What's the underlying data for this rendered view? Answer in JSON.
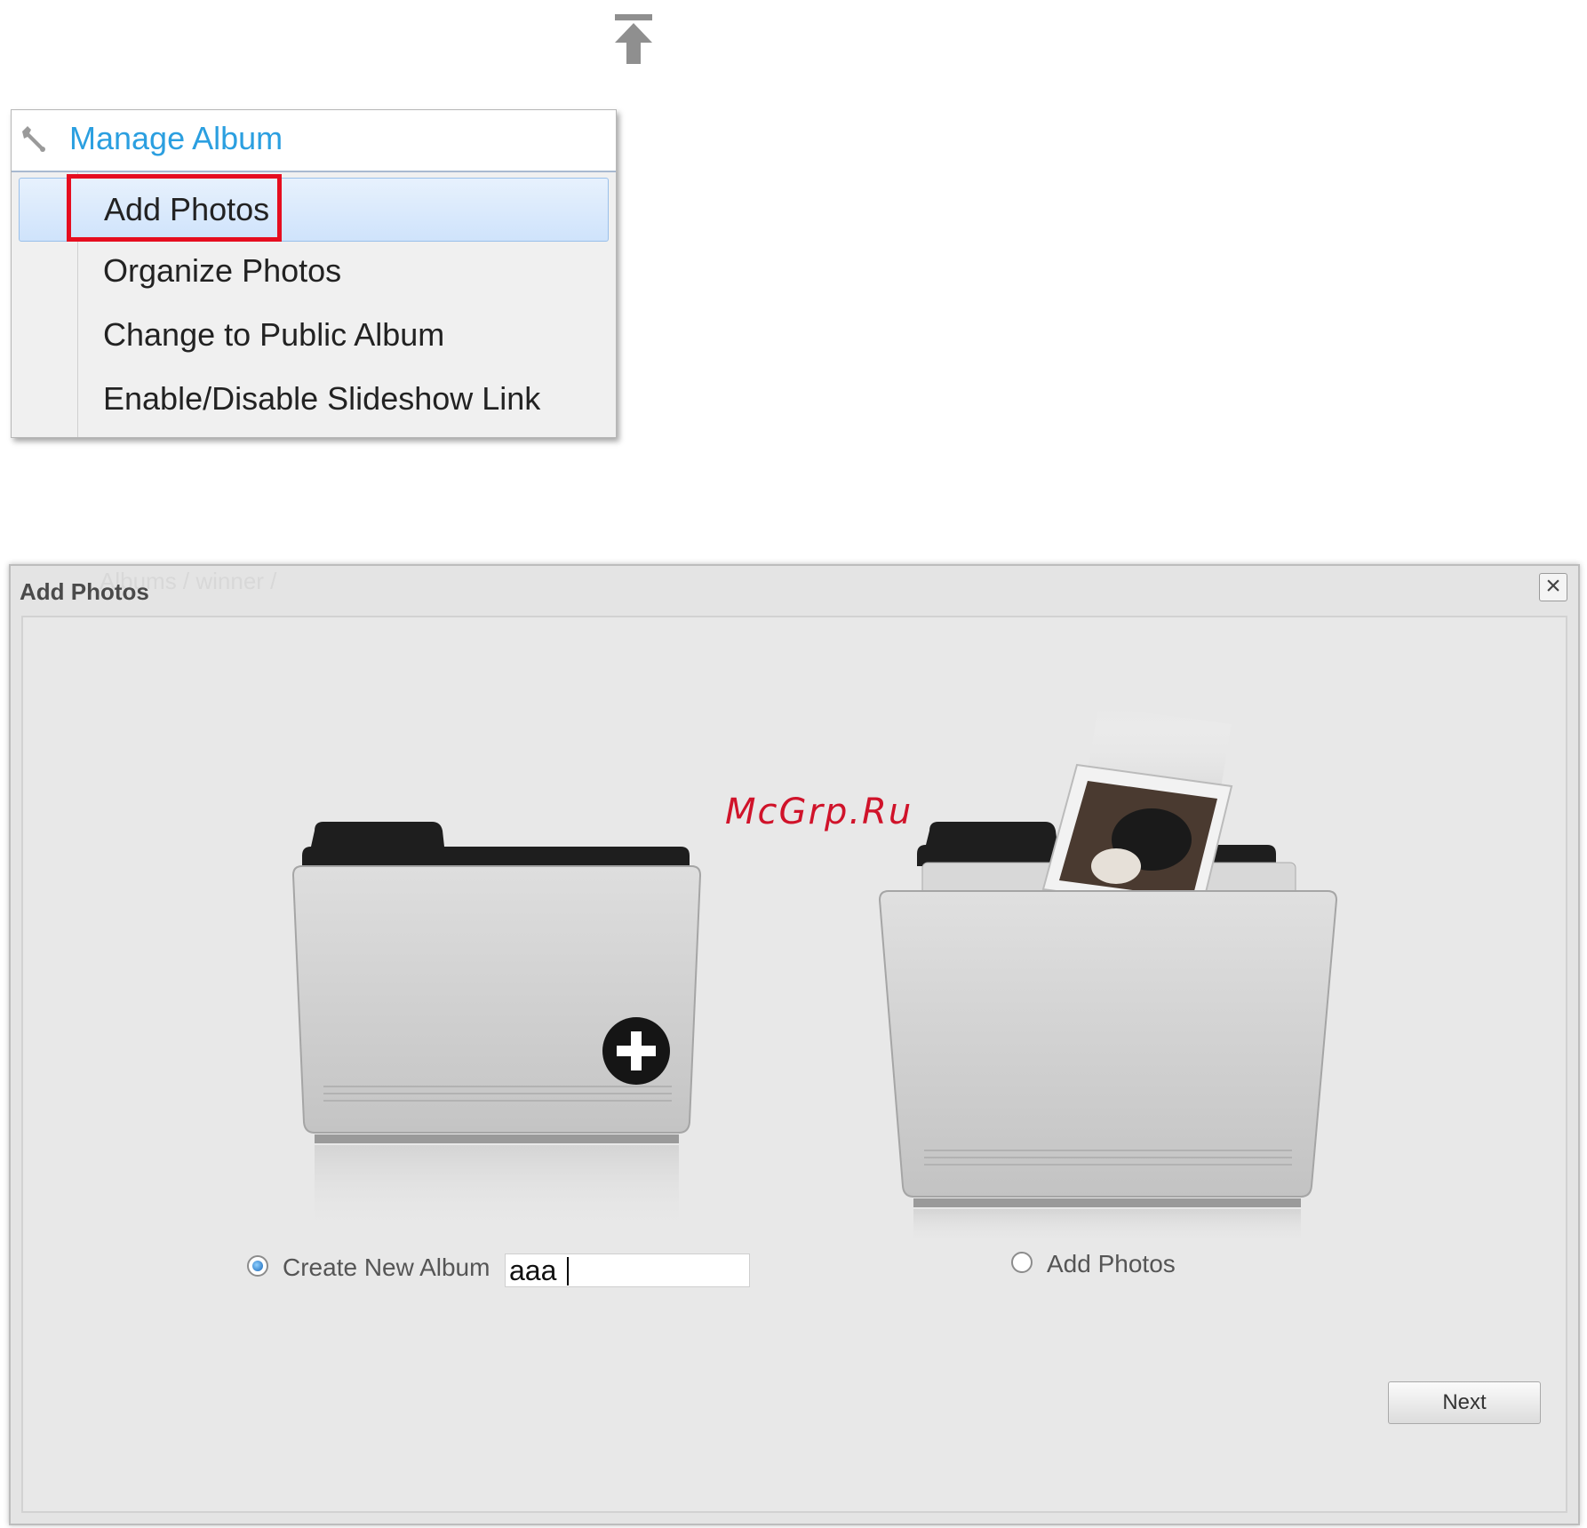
{
  "icons": {
    "upload": "upload-to-top-icon",
    "wrench": "wrench-icon",
    "close": "close-icon",
    "new_folder": "folder-plus-icon",
    "photo_folder": "folder-with-photo-icon"
  },
  "menu": {
    "title": "Manage Album",
    "items": [
      {
        "label": "Add Photos",
        "selected": true
      },
      {
        "label": "Organize Photos",
        "selected": false
      },
      {
        "label": "Change to Public Album",
        "selected": false
      },
      {
        "label": "Enable/Disable Slideshow Link",
        "selected": false
      }
    ]
  },
  "dialog": {
    "title": "Add Photos",
    "ghost_breadcrumb": "Albums / winner /",
    "watermark": "McGrp.Ru",
    "options": {
      "create_new": {
        "label": "Create New Album",
        "selected": true,
        "value": "aaa"
      },
      "add_photos": {
        "label": "Add Photos",
        "selected": false
      }
    },
    "next_label": "Next"
  },
  "colors": {
    "menu_title": "#2b9fe0",
    "highlight_box": "#e60d1f",
    "watermark": "#d0132a"
  }
}
